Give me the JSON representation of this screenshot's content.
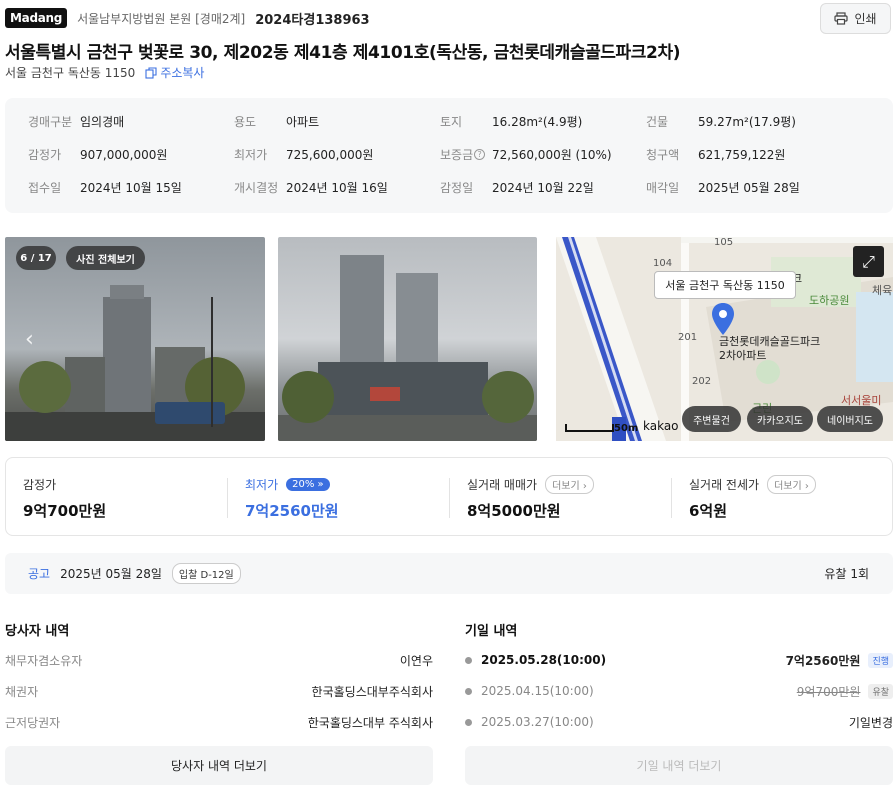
{
  "header": {
    "logo": "Madang",
    "court": "서울남부지방법원 본원 [경매2계]",
    "case_no": "2024타경138963",
    "print_label": "인쇄"
  },
  "title": "서울특별시 금천구 벚꽃로 30, 제202동 제41층 제4101호(독산동, 금천롯데캐슬골드파크2차)",
  "sub_address": "서울 금천구 독산동 1150",
  "copy_label": "주소복사",
  "info": [
    [
      {
        "label": "경매구분",
        "value": "임의경매"
      },
      {
        "label": "용도",
        "value": "아파트"
      },
      {
        "label": "토지",
        "value": "16.28m²(4.9평)"
      },
      {
        "label": "건물",
        "value": "59.27m²(17.9평)"
      }
    ],
    [
      {
        "label": "감정가",
        "value": "907,000,000원"
      },
      {
        "label": "최저가",
        "value": "725,600,000원"
      },
      {
        "label": "보증금",
        "value": "72,560,000원 (10%)"
      },
      {
        "label": "청구액",
        "value": "621,759,122원"
      }
    ],
    [
      {
        "label": "접수일",
        "value": "2024년 10월 15일"
      },
      {
        "label": "개시결정",
        "value": "2024년 10월 16일"
      },
      {
        "label": "감정일",
        "value": "2024년 10월 22일"
      },
      {
        "label": "매각일",
        "value": "2025년 05월 28일"
      }
    ]
  ],
  "photos": {
    "counter": "6 / 17",
    "view_all": "사진 전체보기"
  },
  "map": {
    "tooltip": "서울 금천구 독산동 1150",
    "labels": {
      "n105": "105",
      "n104": "104",
      "n201": "201",
      "n202": "202",
      "park": "도하공원",
      "apt": "금천롯데캐슬골드파크",
      "apt2": "2차아파트",
      "scale": "50m",
      "kakao": "kakao",
      "edge": "서서울미",
      "gym": "체육",
      "kt": "크",
      "geunrin": "근린"
    },
    "buttons": [
      "주변물건",
      "카카오지도",
      "네이버지도"
    ]
  },
  "prices": [
    {
      "label": "감정가",
      "value": "9억700만원"
    },
    {
      "label": "최저가",
      "value": "7억2560만원",
      "badge": "20%"
    },
    {
      "label": "실거래 매매가",
      "value": "8억5000만원",
      "more": "더보기"
    },
    {
      "label": "실거래 전세가",
      "value": "6억원",
      "more": "더보기"
    }
  ],
  "notice": {
    "kw": "공고",
    "date": "2025년 05월 28일",
    "dday": "입찰 D-12일",
    "fail_count": "유찰 1회"
  },
  "parties": {
    "title": "당사자 내역",
    "rows": [
      {
        "label": "채무자겸소유자",
        "value": "이연우"
      },
      {
        "label": "채권자",
        "value": "한국홀딩스대부주식회사"
      },
      {
        "label": "근저당권자",
        "value": "한국홀딩스대부 주식회사"
      }
    ],
    "more_button": "당사자 내역 더보기"
  },
  "history": {
    "title": "기일 내역",
    "rows": [
      {
        "date": "2025.05.28(10:00)",
        "amount": "7억2560만원",
        "tag": "진행"
      },
      {
        "date": "2025.04.15(10:00)",
        "amount": "9억700만원",
        "tag": "유찰"
      },
      {
        "date": "2025.03.27(10:00)",
        "amount": "기일변경",
        "tag": ""
      }
    ],
    "more_button": "기일 내역 더보기"
  }
}
